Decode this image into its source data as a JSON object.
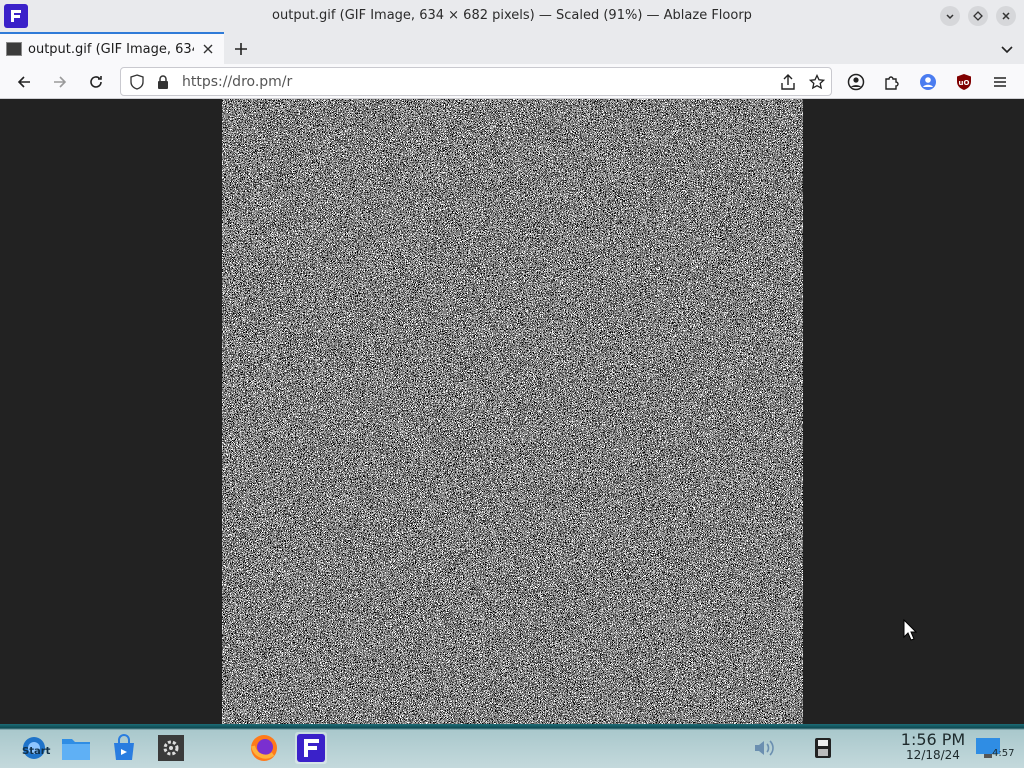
{
  "window": {
    "title": "output.gif (GIF Image, 634 × 682 pixels) — Scaled (91%) — Ablaze Floorp"
  },
  "tabs": [
    {
      "label": "output.gif (GIF Image, 634"
    }
  ],
  "navbar": {
    "url": "https://dro.pm/r"
  },
  "taskbar": {
    "start_label": "Start",
    "clock_time": "1:56 PM",
    "clock_date": "12/18/24",
    "tray_badge": "4:57"
  },
  "colors": {
    "brand": "#3a21c9",
    "tab_accent": "#2f7bd8",
    "content_bg": "#222222"
  }
}
